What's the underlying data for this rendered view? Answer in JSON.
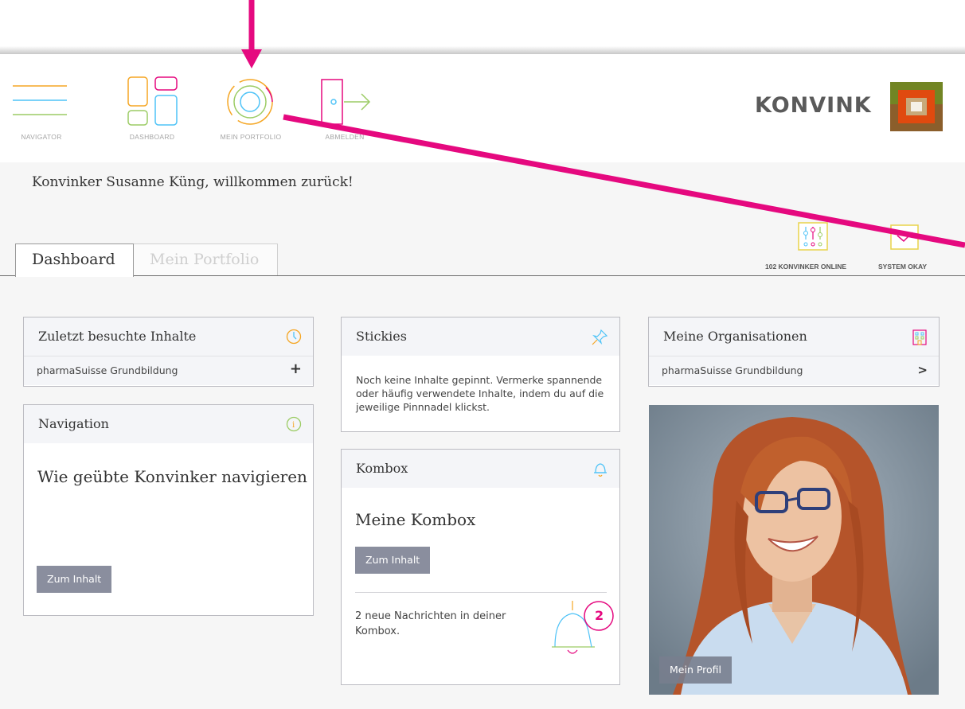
{
  "nav": {
    "navigator": "NAVIGATOR",
    "dashboard": "DASHBOARD",
    "portfolio": "MEIN PORTFOLIO",
    "logout": "ABMELDEN"
  },
  "brand": {
    "name": "KONVINK"
  },
  "welcome": "Konvinker Susanne Küng, willkommen zurück!",
  "tabs": {
    "dashboard": "Dashboard",
    "portfolio": "Mein Portfolio"
  },
  "status": {
    "online": "102 KONVINKER ONLINE",
    "system": "SYSTEM OKAY"
  },
  "cards": {
    "recent": {
      "title": "Zuletzt besuchte Inhalte",
      "item": "pharmaSuisse Grundbildung",
      "action": "+"
    },
    "navigation": {
      "title": "Navigation",
      "heading": "Wie geübte Konvinker navigieren",
      "button": "Zum Inhalt"
    },
    "stickies": {
      "title": "Stickies",
      "text": "Noch keine Inhalte gepinnt. Vermerke spannende oder häufig verwendete Inhalte, indem du auf die jeweilige Pinnnadel klickst."
    },
    "kombox": {
      "title": "Kombox",
      "heading": "Meine Kombox",
      "button": "Zum Inhalt",
      "messages": "2 neue Nachrichten in deiner Kombox.",
      "count": "2"
    },
    "orgs": {
      "title": "Meine Organisationen",
      "item": "pharmaSuisse Grundbildung",
      "action": ">"
    },
    "profile": {
      "button": "Mein Profil"
    }
  },
  "colors": {
    "annotation": "#e5097f",
    "accent_orange": "#f5a623",
    "accent_blue": "#4fc3f7",
    "accent_green": "#9ccc65",
    "button": "#8a8e9e"
  }
}
